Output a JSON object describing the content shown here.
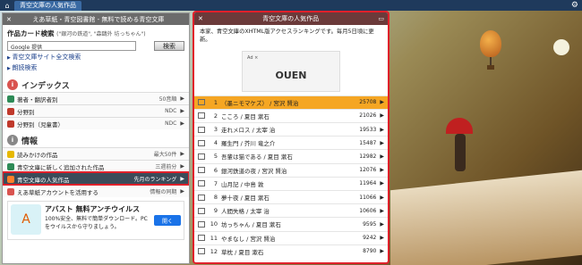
{
  "topbar": {
    "tab_label": "青空文庫の人気作品"
  },
  "left": {
    "header": {
      "title": "えあ草紙・青空図書館 - 無料で読める青空文庫"
    },
    "search": {
      "title": "作品カード検索",
      "hint": "(\"銀河の鉄道\", \"森鷗外 坊っちゃん\")",
      "placeholder": "Google 提供",
      "button": "検索"
    },
    "links": [
      "青空文庫サイト全文検索",
      "朗読検索"
    ],
    "index": {
      "heading": "インデックス",
      "icon": "i",
      "rows": [
        {
          "label": "著者・翻訳者別",
          "right": "50音順",
          "color": "#2e8b57"
        },
        {
          "label": "分野別",
          "right": "NDC",
          "color": "#c0392b"
        },
        {
          "label": "分野別（児童書）",
          "right": "NDC",
          "color": "#c0392b"
        }
      ]
    },
    "info": {
      "heading": "情報",
      "icon": "i",
      "rows": [
        {
          "label": "読みかけの作品",
          "right": "最大50件",
          "color": "#e6b800"
        },
        {
          "label": "青空文庫に新しく追加された作品",
          "right": "三週前分",
          "color": "#2e8b57"
        },
        {
          "label": "青空文庫の人気作品",
          "right": "先月のランキング",
          "color": "#ff7f2a",
          "selected": true
        },
        {
          "label": "えあ草紙アカウントを活用する",
          "right": "情報の同期",
          "color": "#d9534f"
        }
      ]
    },
    "ad": {
      "title": "アバスト 無料アンチウイルス",
      "text": "100%安全、無料で簡単ダウンロード。PCをウイルスから守りましょう。",
      "button": "開く"
    }
  },
  "center": {
    "header": {
      "title": "青空文庫の人気作品"
    },
    "description": "本家、青空文庫のXHTML版アクセスランキングです。毎月5日頃に更新。",
    "ad": {
      "brand": "OUEN",
      "note": "Ad ×"
    },
    "ranking": [
      {
        "rank": "1",
        "title": "（墨ニモマケズ） / 宮沢 賢治",
        "count": "25708"
      },
      {
        "rank": "2",
        "title": "こころ / 夏目 漱石",
        "count": "21026"
      },
      {
        "rank": "3",
        "title": "走れメロス / 太宰 治",
        "count": "19533"
      },
      {
        "rank": "4",
        "title": "羅生門 / 芥川 竜之介",
        "count": "15487"
      },
      {
        "rank": "5",
        "title": "吾輩は猫である / 夏目 漱石",
        "count": "12982"
      },
      {
        "rank": "6",
        "title": "銀河鉄道の夜 / 宮沢 賢治",
        "count": "12076"
      },
      {
        "rank": "7",
        "title": "山月記 / 中島 敦",
        "count": "11964"
      },
      {
        "rank": "8",
        "title": "夢十夜 / 夏目 漱石",
        "count": "11066"
      },
      {
        "rank": "9",
        "title": "人間失格 / 太宰 治",
        "count": "10606"
      },
      {
        "rank": "10",
        "title": "坊っちゃん / 夏目 漱石",
        "count": "9595"
      },
      {
        "rank": "11",
        "title": "やまなし / 宮沢 賢治",
        "count": "9242"
      },
      {
        "rank": "12",
        "title": "草枕 / 夏目 漱石",
        "count": "8790"
      }
    ]
  },
  "colors": {
    "accent_red": "#e0202a",
    "top_rank": "#f5a623",
    "selected_row": "#3b4b59"
  }
}
